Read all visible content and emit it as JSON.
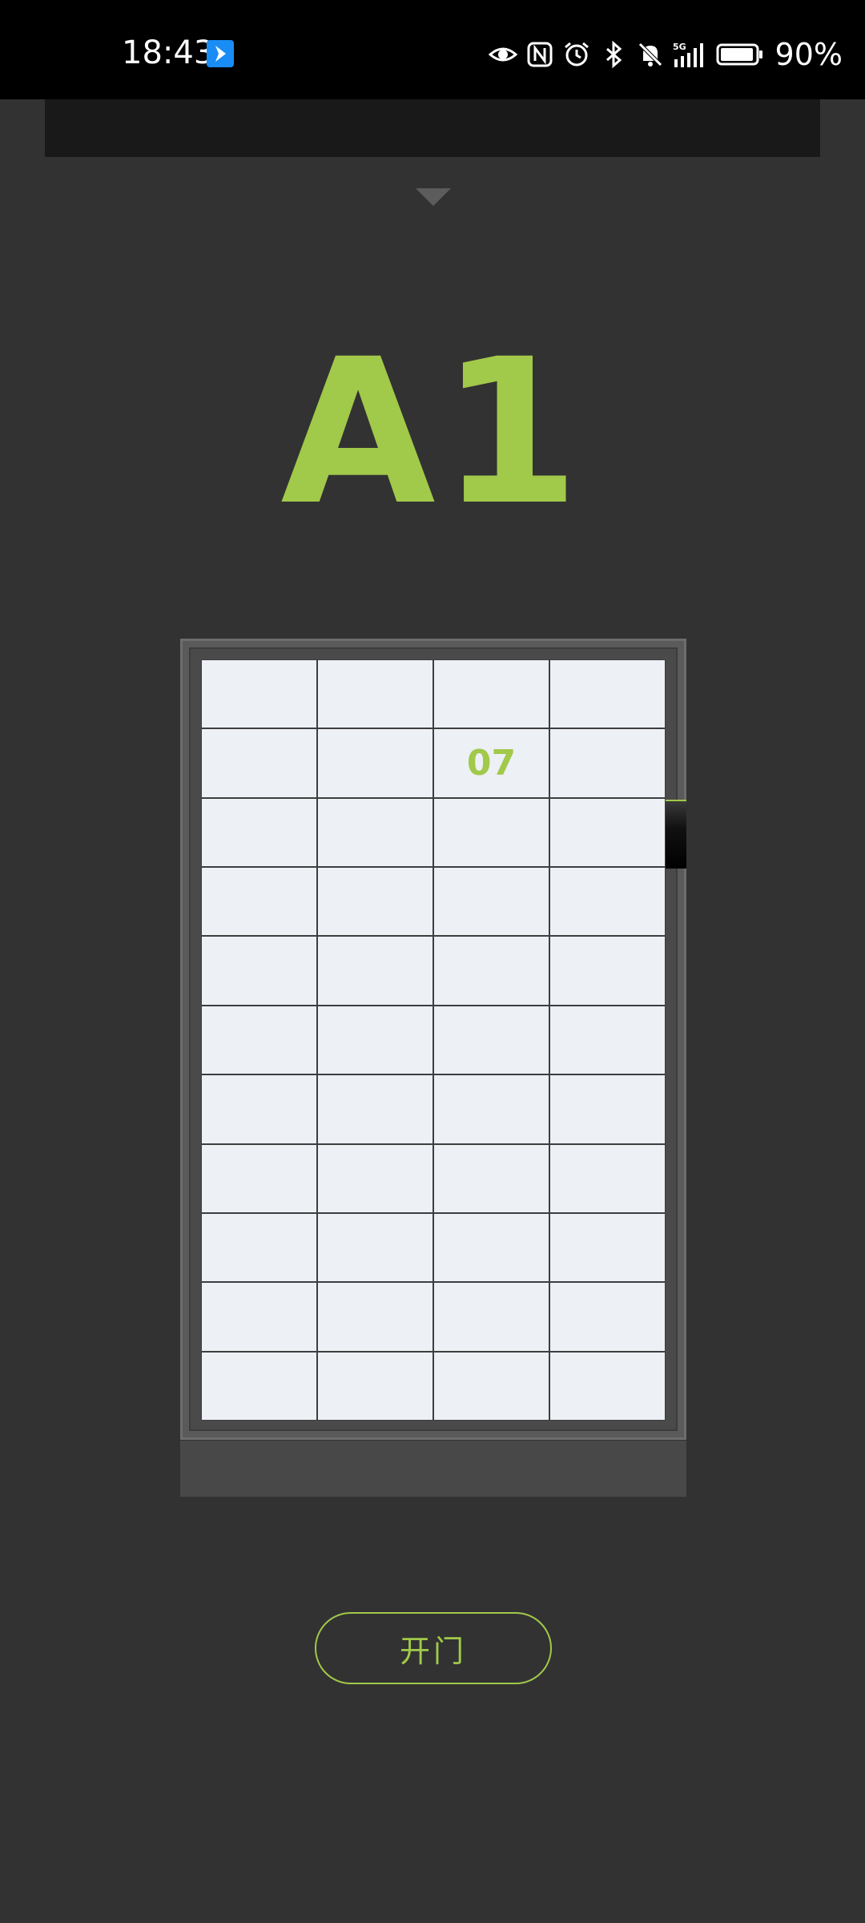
{
  "status_bar": {
    "time": "18:43",
    "battery_percent": "90%",
    "network": "5G",
    "icons": [
      "app-notification-icon",
      "eye-icon",
      "nfc-icon",
      "alarm-icon",
      "bluetooth-icon",
      "mute-icon",
      "signal-icon",
      "battery-icon"
    ]
  },
  "locker": {
    "title": "A1",
    "columns": 4,
    "rows": 11,
    "compartments": [
      "",
      "",
      "",
      "",
      "",
      "",
      "07",
      "",
      "",
      "",
      "",
      "",
      "",
      "",
      "",
      "",
      "",
      "",
      "",
      "",
      "",
      "",
      "",
      "",
      "",
      "",
      "",
      "",
      "",
      "",
      "",
      "",
      "",
      "",
      "",
      "",
      "",
      "",
      "",
      "",
      "",
      "",
      "",
      ""
    ],
    "selected_compartment": "07"
  },
  "actions": {
    "open_door_label": "开门"
  },
  "colors": {
    "accent": "#a1c94a",
    "background": "#323232",
    "compartment": "#edf0f5"
  }
}
